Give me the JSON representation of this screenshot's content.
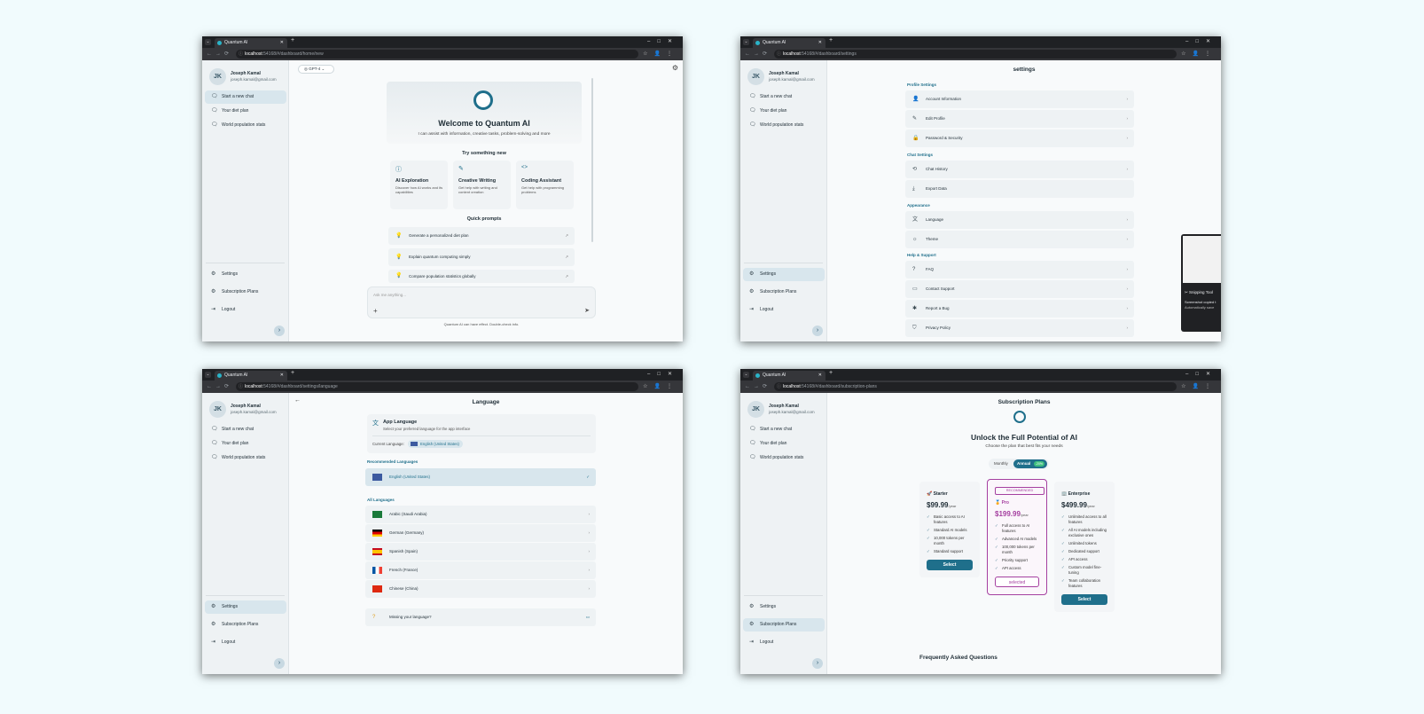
{
  "browser": {
    "tab_title": "Quantum AI",
    "url_host": "localhost",
    "urls": [
      ":54168/#/dashboard/home/new",
      ":54168/#/dashboard/settings",
      ":54168/#/dashboard/settings/language",
      ":54168/#/dashboard/subscription-plans"
    ]
  },
  "sidebar": {
    "initials": "JK",
    "name": "Joseph Kamal",
    "email": "joseph.kamal@gmail.com",
    "items": [
      "Start a new chat",
      "Your diet plan",
      "World population stats"
    ],
    "bottom": [
      "Settings",
      "Subscription Plans",
      "Logout"
    ]
  },
  "home": {
    "model": "GPT-4",
    "welcome": "Welcome to Quantum AI",
    "subtitle": "I can assist with information, creative tasks, problem-solving and more",
    "try_title": "Try something new",
    "features": [
      {
        "title": "AI Exploration",
        "desc": "Discover how AI works and its capabilities"
      },
      {
        "title": "Creative Writing",
        "desc": "Get help with writing and content creation"
      },
      {
        "title": "Coding Assistant",
        "desc": "Get help with programming problems"
      }
    ],
    "quick_title": "Quick prompts",
    "prompts": [
      "Generate a personalized diet plan",
      "Explain quantum computing simply",
      "Compare population statistics globally"
    ],
    "input_placeholder": "Ask me anything...",
    "disclaimer": "Quantum AI can have effect. Double-check info."
  },
  "settings": {
    "title": "settings",
    "sections": [
      {
        "title": "Profile Settings",
        "items": [
          "Account Information",
          "Edit Profile",
          "Password & Security"
        ]
      },
      {
        "title": "Chat Settings",
        "items": [
          "Chat History",
          "Export Data"
        ]
      },
      {
        "title": "Appearance",
        "items": [
          "Language",
          "Theme"
        ]
      },
      {
        "title": "Help & Support",
        "items": [
          "FAQ",
          "Contact Support",
          "Report a Bug",
          "Privacy Policy"
        ]
      }
    ],
    "snip_title": "Snipping Tool",
    "snip_line1": "Screenshot copied t",
    "snip_line2": "Automatically save"
  },
  "language": {
    "title": "Language",
    "app_lang_title": "App Language",
    "app_lang_desc": "Select your preferred language for the app interface",
    "current_label": "Current Language:",
    "current_value": "English (United States)",
    "recommended_title": "Recommended Languages",
    "recommended": "English (United States)",
    "all_title": "All Languages",
    "all": [
      "Arabic (Saudi Arabia)",
      "German (Germany)",
      "Spanish (Spain)",
      "French (France)",
      "Chinese (China)"
    ],
    "missing": "Missing your language?"
  },
  "plans": {
    "title": "Subscription Plans",
    "headline": "Unlock the Full Potential of AI",
    "subline": "Choose the plan that best fits your needs",
    "toggle_monthly": "Monthly",
    "toggle_annual": "Annual",
    "toggle_badge": "-20%",
    "recommended_badge": "RECOMMENDED",
    "cards": [
      {
        "name": "Starter",
        "price": "$99.99",
        "period": "/year",
        "features": [
          "Basic access to AI features",
          "Standard AI models",
          "10,000 tokens per month",
          "Standard support"
        ],
        "button": "Select"
      },
      {
        "name": "Pro",
        "price": "$199.99",
        "period": "/year",
        "features": [
          "Full access to AI features",
          "Advanced AI models",
          "100,000 tokens per month",
          "Priority support",
          "API access"
        ],
        "button": "selected"
      },
      {
        "name": "Enterprise",
        "price": "$499.99",
        "period": "/year",
        "features": [
          "Unlimited access to all features",
          "All AI models including exclusive ones",
          "Unlimited tokens",
          "Dedicated support",
          "API access",
          "Custom model fine-tuning",
          "Team collaboration features"
        ],
        "button": "Select"
      }
    ],
    "faq_title": "Frequently Asked Questions"
  },
  "colors": {
    "accent": "#1f6f8b",
    "pro": "#a540a0",
    "sidebar_active": "#d8e6ed"
  }
}
